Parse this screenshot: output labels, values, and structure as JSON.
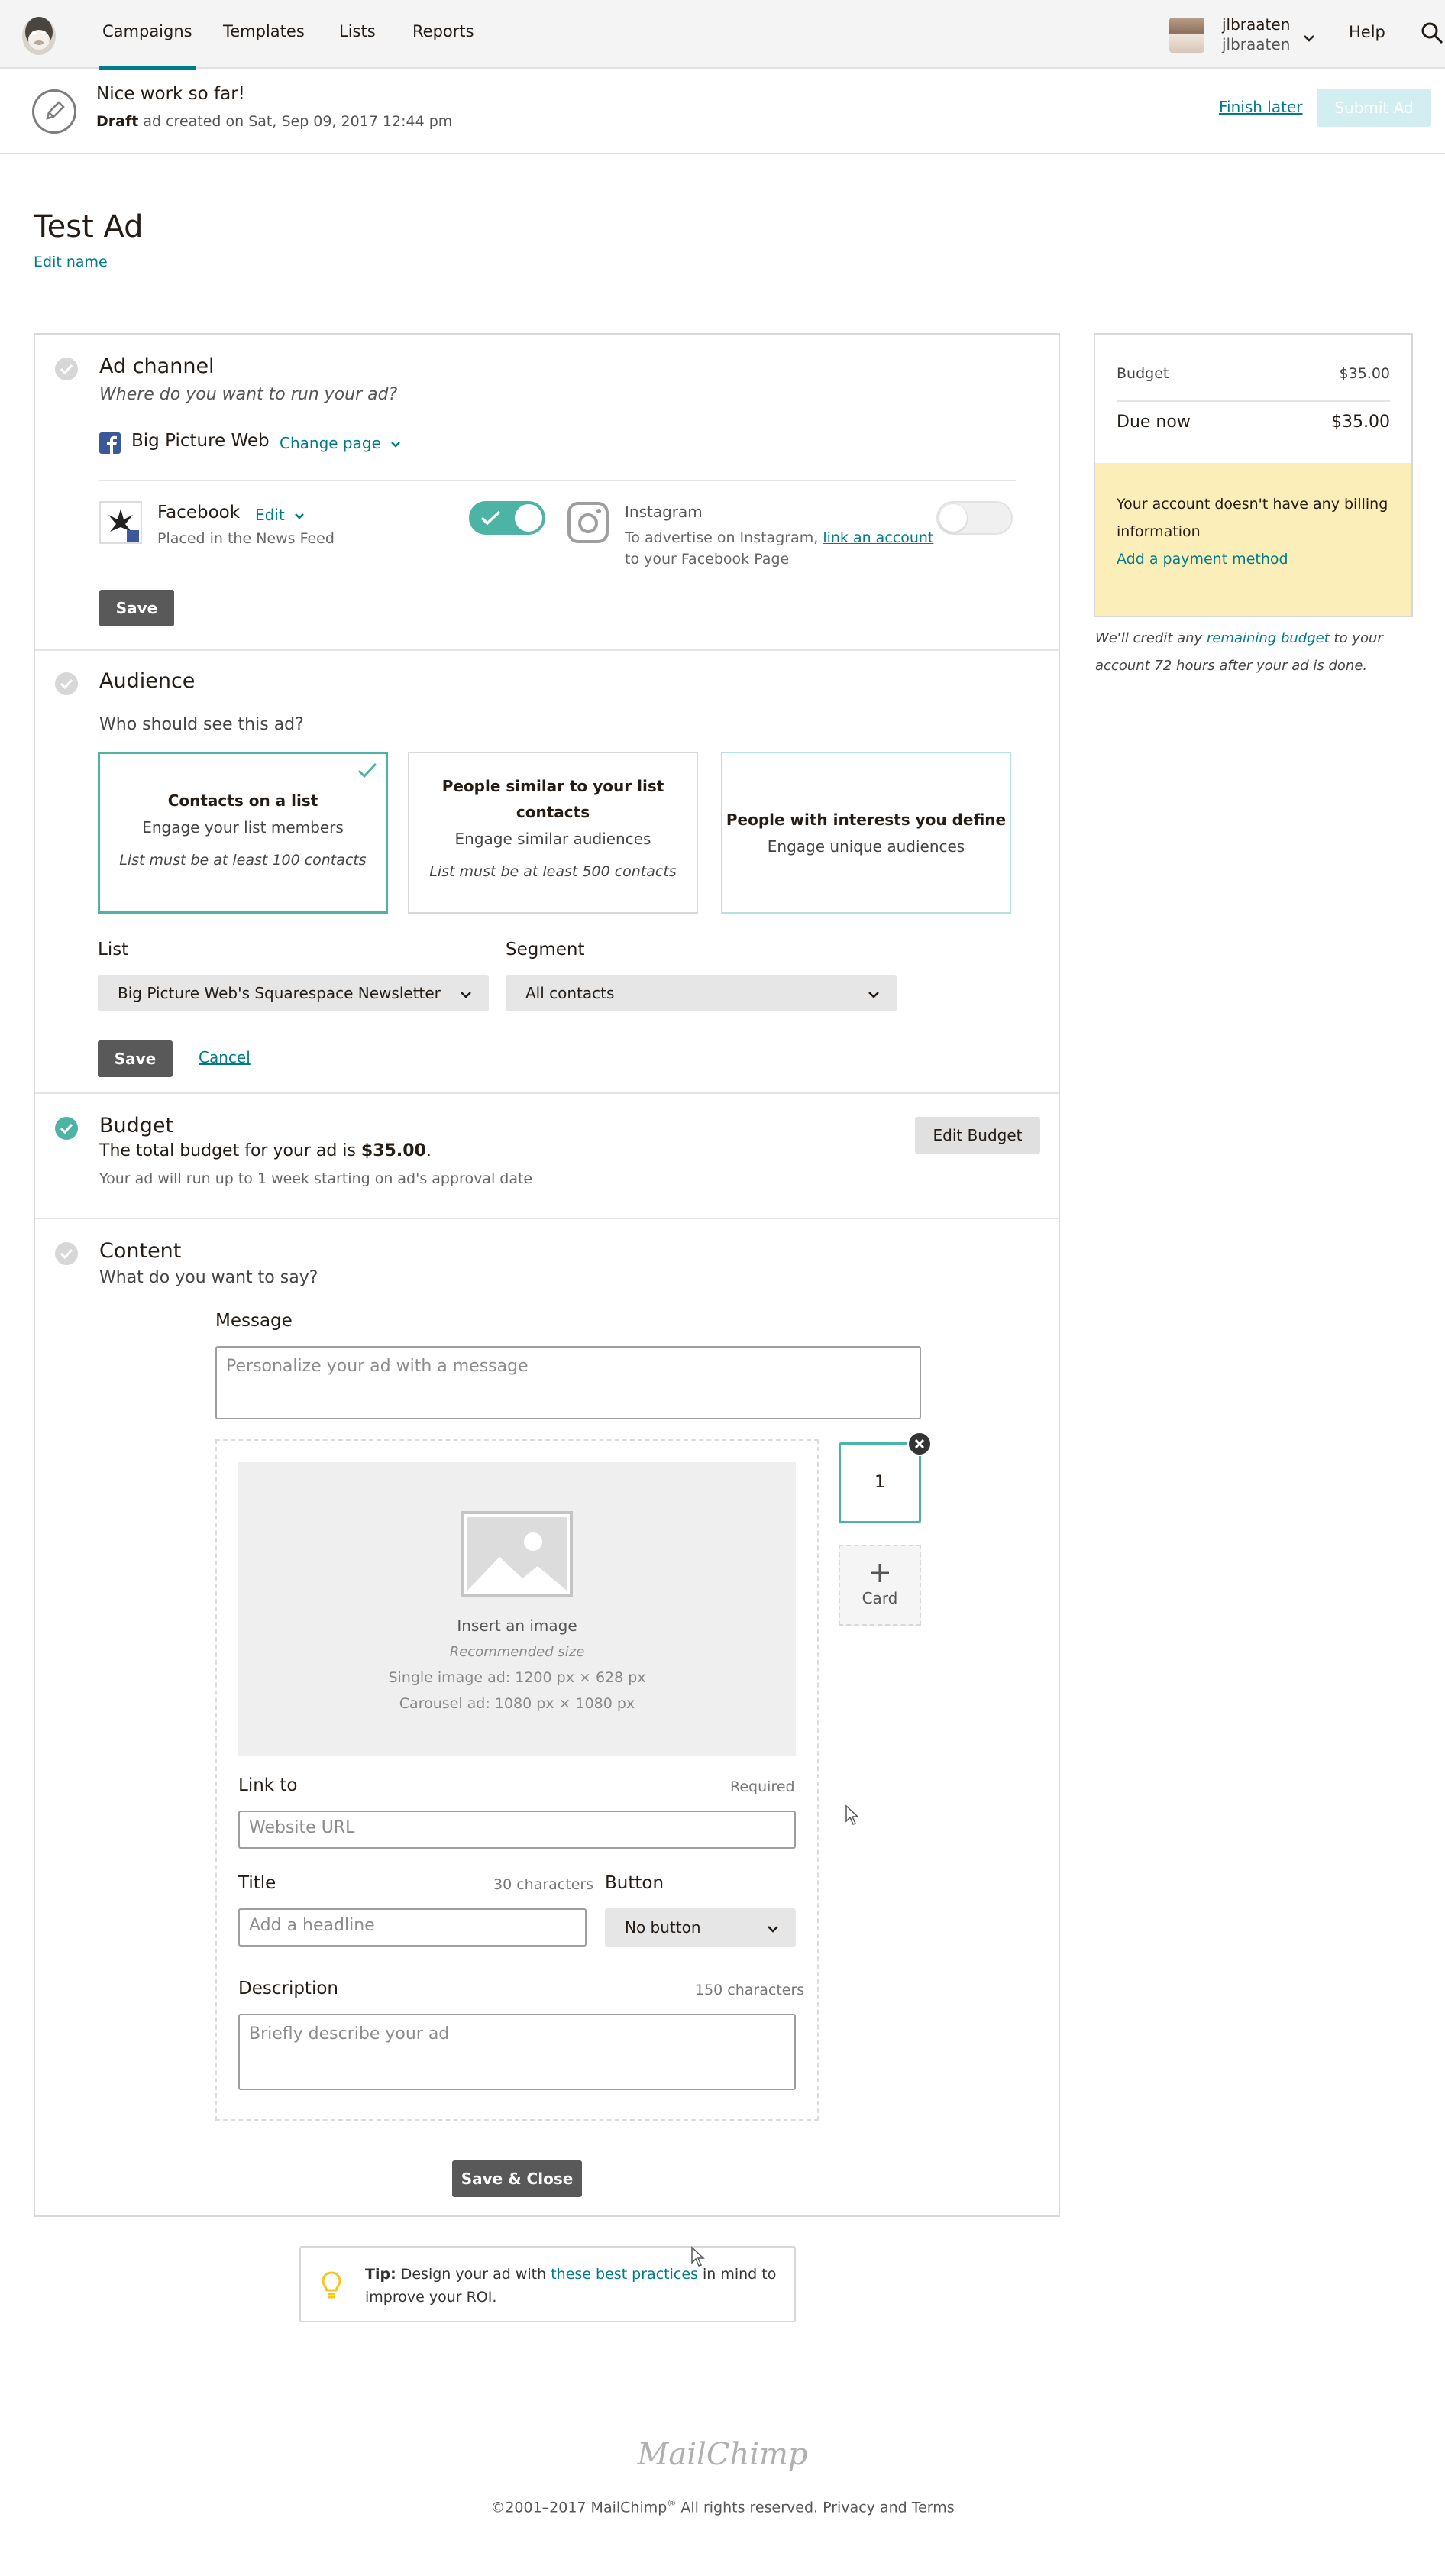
{
  "nav": {
    "items": [
      "Campaigns",
      "Templates",
      "Lists",
      "Reports"
    ],
    "user": {
      "name": "jlbraaten",
      "username": "jlbraaten"
    },
    "help": "Help"
  },
  "status": {
    "title": "Nice work so far!",
    "draft_label": "Draft",
    "draft_text": "ad created on Sat, Sep 09, 2017 12:44 pm",
    "finish_later": "Finish later",
    "submit": "Submit Ad"
  },
  "page": {
    "title": "Test Ad",
    "edit_name": "Edit name"
  },
  "ad_channel": {
    "title": "Ad channel",
    "subtitle": "Where do you want to run your ad?",
    "page_name": "Big Picture Web",
    "change_page": "Change page",
    "facebook": {
      "label": "Facebook",
      "edit": "Edit",
      "placement": "Placed in the News Feed",
      "enabled": true
    },
    "instagram": {
      "label": "Instagram",
      "text_before": "To advertise on Instagram,",
      "link": "link an account",
      "text_after": "to your Facebook Page",
      "enabled": false
    },
    "save": "Save"
  },
  "audience": {
    "title": "Audience",
    "question": "Who should see this ad?",
    "cards": [
      {
        "title": "Contacts on a list",
        "desc": "Engage your list members",
        "note": "List must be at least 100 contacts",
        "selected": true
      },
      {
        "title": "People similar to your list contacts",
        "desc": "Engage similar audiences",
        "note": "List must be at least 500 contacts",
        "selected": false
      },
      {
        "title": "People with interests you define",
        "desc": "Engage unique audiences",
        "note": "",
        "selected": false
      }
    ],
    "list_label": "List",
    "list_value": "Big Picture Web's Squarespace Newsletter",
    "segment_label": "Segment",
    "segment_value": "All contacts",
    "save": "Save",
    "cancel": "Cancel"
  },
  "budget": {
    "title": "Budget",
    "text_before": "The total budget for your ad is",
    "amount": "$35.00",
    "text_after": ".",
    "run_note": "Your ad will run up to 1 week starting on ad's approval date",
    "edit_button": "Edit Budget"
  },
  "content": {
    "title": "Content",
    "question": "What do you want to say?",
    "message_label": "Message",
    "message_placeholder": "Personalize your ad with a message",
    "image": {
      "insert": "Insert an image",
      "recommended": "Recommended size",
      "single": "Single image ad: 1200 px × 628 px",
      "carousel": "Carousel ad: 1080 px × 1080 px"
    },
    "link_label": "Link to",
    "link_required": "Required",
    "link_placeholder": "Website URL",
    "title_label": "Title",
    "title_hint": "30 characters",
    "title_placeholder": "Add a headline",
    "button_label": "Button",
    "button_value": "No button",
    "desc_label": "Description",
    "desc_hint": "150 characters",
    "desc_placeholder": "Briefly describe your ad",
    "card_number": "1",
    "add_card": "Card",
    "save_close": "Save & Close"
  },
  "sidebar": {
    "budget_label": "Budget",
    "budget_value": "$35.00",
    "due_label": "Due now",
    "due_value": "$35.00",
    "warning": "Your account doesn't have any billing information",
    "add_payment": "Add a payment method",
    "note_before": "We'll credit any",
    "note_link": "remaining budget",
    "note_after": "to your account 72 hours after your ad is done."
  },
  "tip": {
    "label": "Tip:",
    "text_before": "Design your ad with",
    "link": "these best practices",
    "text_after": "in mind to improve your ROI."
  },
  "footer": {
    "logo": "MailChimp",
    "copy_before": "©2001–2017 MailChimp",
    "reg": "®",
    "copy_mid": " All rights reserved.",
    "privacy": "Privacy",
    "and": "and",
    "terms": "Terms"
  },
  "colors": {
    "accent": "#007c89",
    "success": "#4cb3a5",
    "warning_bg": "#fbeeb8",
    "nav_bg": "#f4f4f4"
  }
}
